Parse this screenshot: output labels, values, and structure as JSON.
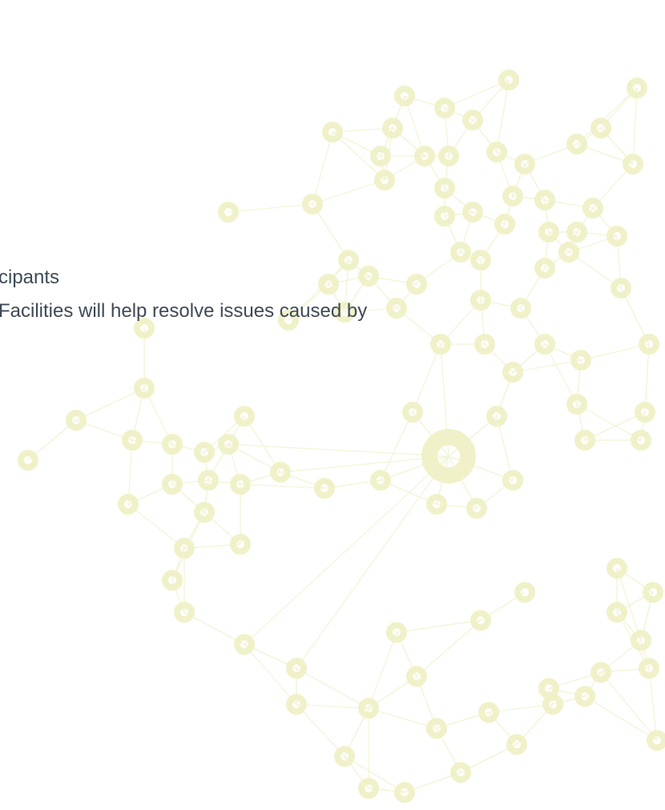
{
  "document": {
    "lines": [
      "cipants",
      "Facilities will help resolve issues caused by"
    ]
  },
  "background": {
    "icon": "network-graph-icon",
    "node_color": "#f1f1c9",
    "edge_color": "#f5f5dc"
  }
}
